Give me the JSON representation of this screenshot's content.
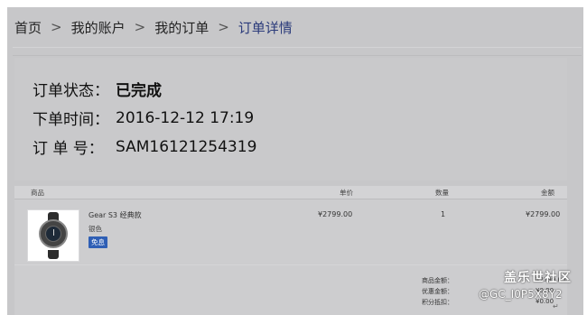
{
  "breadcrumb": {
    "items": [
      "首页",
      "我的账户",
      "我的订单"
    ],
    "current": "订单详情",
    "separator": ">"
  },
  "order": {
    "status_label": "订单状态：",
    "status_value": "已完成",
    "time_label": "下单时间：",
    "time_value": "2016-12-12 17:19",
    "number_label": "订 单 号：",
    "number_value": "SAM16121254319"
  },
  "table": {
    "headers": {
      "product": "商品",
      "price": "单价",
      "quantity": "数量",
      "amount": "金额"
    },
    "items": [
      {
        "name": "Gear S3 经典款",
        "color": "银色",
        "badge": "免息",
        "price": "¥2799.00",
        "quantity": "1",
        "amount": "¥2799.00",
        "image_icon": "smartwatch-icon"
      }
    ]
  },
  "summary": [
    {
      "label": "商品金额：",
      "value": "¥2799.00"
    },
    {
      "label": "优惠金额：",
      "value": "¥0.00"
    },
    {
      "label": "积分抵扣：",
      "value": "¥0.00"
    }
  ],
  "watermark": {
    "brand": "盖乐世社区",
    "user": "@GC_I0P5X8Y2"
  },
  "colors": {
    "background": "#c7c7c9",
    "breadcrumb_current": "#2a3a7a",
    "badge": "#2f5fb5"
  }
}
